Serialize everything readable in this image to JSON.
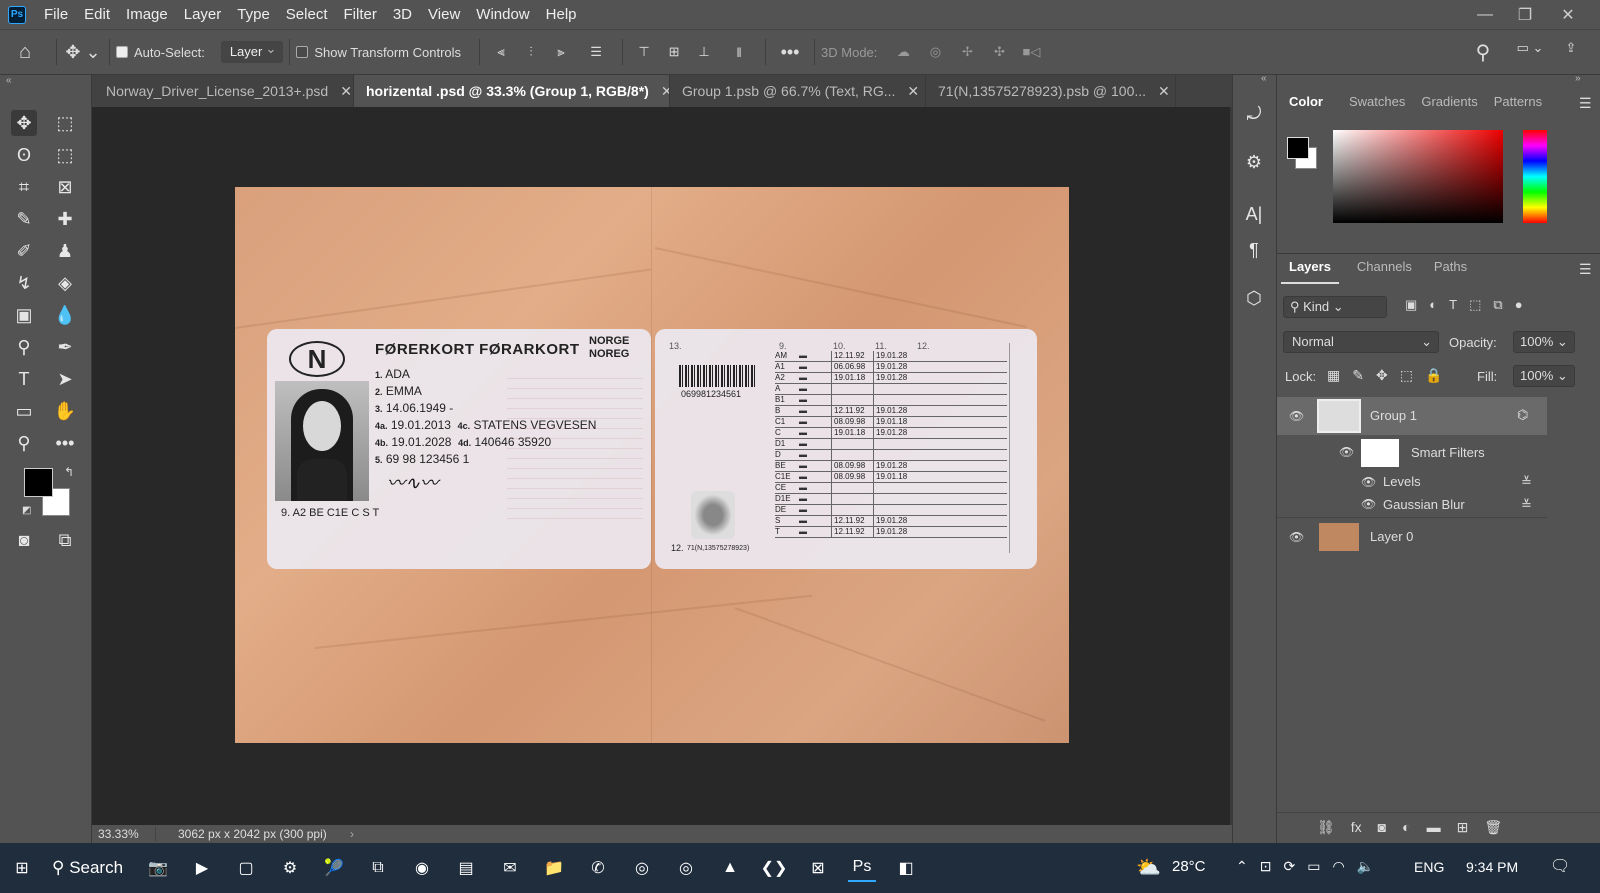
{
  "menu": {
    "logo": "Ps",
    "items": [
      "File",
      "Edit",
      "Image",
      "Layer",
      "Type",
      "Select",
      "Filter",
      "3D",
      "View",
      "Window",
      "Help"
    ]
  },
  "options": {
    "auto_select_label": "Auto-Select:",
    "auto_select_target": "Layer",
    "show_transform_label": "Show Transform Controls",
    "mode_3d_label": "3D Mode:"
  },
  "tabs": [
    {
      "label": "Norway_Driver_License_2013+.psd"
    },
    {
      "label": "horizental .psd @ 33.3% (Group 1, RGB/8*)"
    },
    {
      "label": "Group 1.psb @ 66.7% (Text, RG..."
    },
    {
      "label": "71(N,13575278923).psb @ 100..."
    }
  ],
  "card_front": {
    "country_mark": "N",
    "title": "FØRERKORT  FØRARKORT",
    "country_1": "NORGE",
    "country_2": "NOREG",
    "line1": "ADA",
    "line2": "EMMA",
    "line3": "14.06.1949  -",
    "line4a": "19.01.2013",
    "line4c": "STATENS VEGVESEN",
    "line4b": "19.01.2028",
    "line4d": "140646 35920",
    "line5": "69 98 123456 1",
    "line9": "9. A2 BE C1E C  S T",
    "lbl1": "1.",
    "lbl2": "2.",
    "lbl3": "3.",
    "lbl4a": "4a.",
    "lbl4c": "4c.",
    "lbl4b": "4b.",
    "lbl4d": "4d.",
    "lbl5": "5."
  },
  "card_back": {
    "lbl13": "13.",
    "barcode_number": "069981234561",
    "lbl12": "12.",
    "code12": "71(N,13575278923)",
    "col9": "9.",
    "col10": "10.",
    "col11": "11.",
    "col12": "12.",
    "rows": [
      {
        "cat": "AM",
        "d10": "12.11.92",
        "d11": "19.01.28"
      },
      {
        "cat": "A1",
        "d10": "06.06.98",
        "d11": "19.01.28"
      },
      {
        "cat": "A2",
        "d10": "19.01.18",
        "d11": "19.01.28"
      },
      {
        "cat": "A",
        "d10": "",
        "d11": ""
      },
      {
        "cat": "B1",
        "d10": "",
        "d11": ""
      },
      {
        "cat": "B",
        "d10": "12.11.92",
        "d11": "19.01.28"
      },
      {
        "cat": "C1",
        "d10": "08.09.98",
        "d11": "19.01.18"
      },
      {
        "cat": "C",
        "d10": "19.01.18",
        "d11": "19.01.28"
      },
      {
        "cat": "D1",
        "d10": "",
        "d11": ""
      },
      {
        "cat": "D",
        "d10": "",
        "d11": ""
      },
      {
        "cat": "BE",
        "d10": "08.09.98",
        "d11": "19.01.28"
      },
      {
        "cat": "C1E",
        "d10": "08.09.98",
        "d11": "19.01.18"
      },
      {
        "cat": "CE",
        "d10": "",
        "d11": ""
      },
      {
        "cat": "D1E",
        "d10": "",
        "d11": ""
      },
      {
        "cat": "DE",
        "d10": "",
        "d11": ""
      },
      {
        "cat": "S",
        "d10": "12.11.92",
        "d11": "19.01.28"
      },
      {
        "cat": "T",
        "d10": "12.11.92",
        "d11": "19.01.28"
      }
    ]
  },
  "status": {
    "zoom": "33.33%",
    "doc_size": "3062 px x 2042 px (300 ppi)"
  },
  "color_panel": {
    "tabs": [
      "Color",
      "Swatches",
      "Gradients",
      "Patterns"
    ]
  },
  "layers_panel": {
    "tabs": [
      "Layers",
      "Channels",
      "Paths"
    ],
    "filter_kind": "Kind",
    "blend_mode": "Normal",
    "opacity_label": "Opacity:",
    "opacity": "100%",
    "lock_label": "Lock:",
    "fill_label": "Fill:",
    "fill": "100%",
    "layers": [
      {
        "name": "Group 1"
      },
      {
        "name": "Smart Filters"
      },
      {
        "name": "Levels"
      },
      {
        "name": "Gaussian Blur"
      },
      {
        "name": "Layer 0"
      }
    ]
  },
  "taskbar": {
    "search": "Search",
    "weather": "28°C",
    "language": "ENG",
    "time": "9:34 PM"
  },
  "colors": {
    "accent": "#31a8ff",
    "panel": "#535353",
    "canvas": "#282828",
    "taskbar": "#1f2d3d"
  }
}
